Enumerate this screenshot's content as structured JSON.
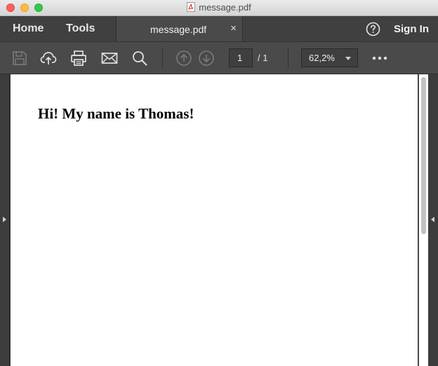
{
  "window": {
    "title": "message.pdf"
  },
  "nav": {
    "home_label": "Home",
    "tools_label": "Tools",
    "tab_label": "message.pdf",
    "tab_close": "×",
    "signin_label": "Sign In"
  },
  "toolbar": {
    "current_page": "1",
    "page_total": "/ 1",
    "zoom": "62,2%",
    "icons": [
      "save-icon",
      "upload-cloud-icon",
      "print-icon",
      "email-icon",
      "search-icon",
      "page-up-icon",
      "page-down-icon",
      "more-icon"
    ]
  },
  "document": {
    "text": "Hi! My name is Thomas!"
  },
  "colors": {
    "chrome_dark": "#404040",
    "toolbar": "#4a4a4a",
    "page": "#ffffff"
  }
}
